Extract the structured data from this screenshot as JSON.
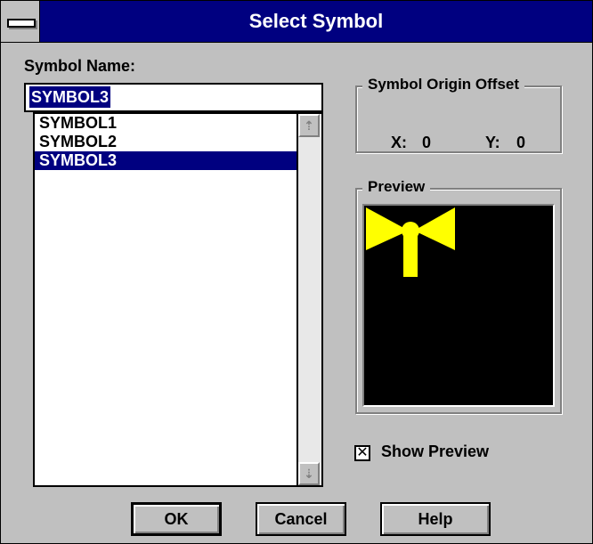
{
  "window": {
    "title": "Select Symbol"
  },
  "symbol_name": {
    "label": "Symbol Name:",
    "value": "SYMBOL3"
  },
  "symbol_list": {
    "items": [
      "SYMBOL1",
      "SYMBOL2",
      "SYMBOL3"
    ],
    "selected_index": 2,
    "scroll_up_icon": "arrow-up-icon",
    "scroll_down_icon": "arrow-down-icon"
  },
  "origin_offset": {
    "legend": "Symbol Origin Offset",
    "x_label": "X:",
    "x_value": "0",
    "y_label": "Y:",
    "y_value": "0"
  },
  "preview": {
    "legend": "Preview",
    "background_color": "#000000",
    "symbol_color": "#ffff00"
  },
  "show_preview": {
    "label": "Show Preview",
    "checked": true,
    "mark": "✕"
  },
  "buttons": {
    "ok": "OK",
    "cancel": "Cancel",
    "help": "Help"
  },
  "colors": {
    "title_bar": "#000080",
    "dialog_face": "#c0c0c0",
    "selection": "#000080"
  }
}
